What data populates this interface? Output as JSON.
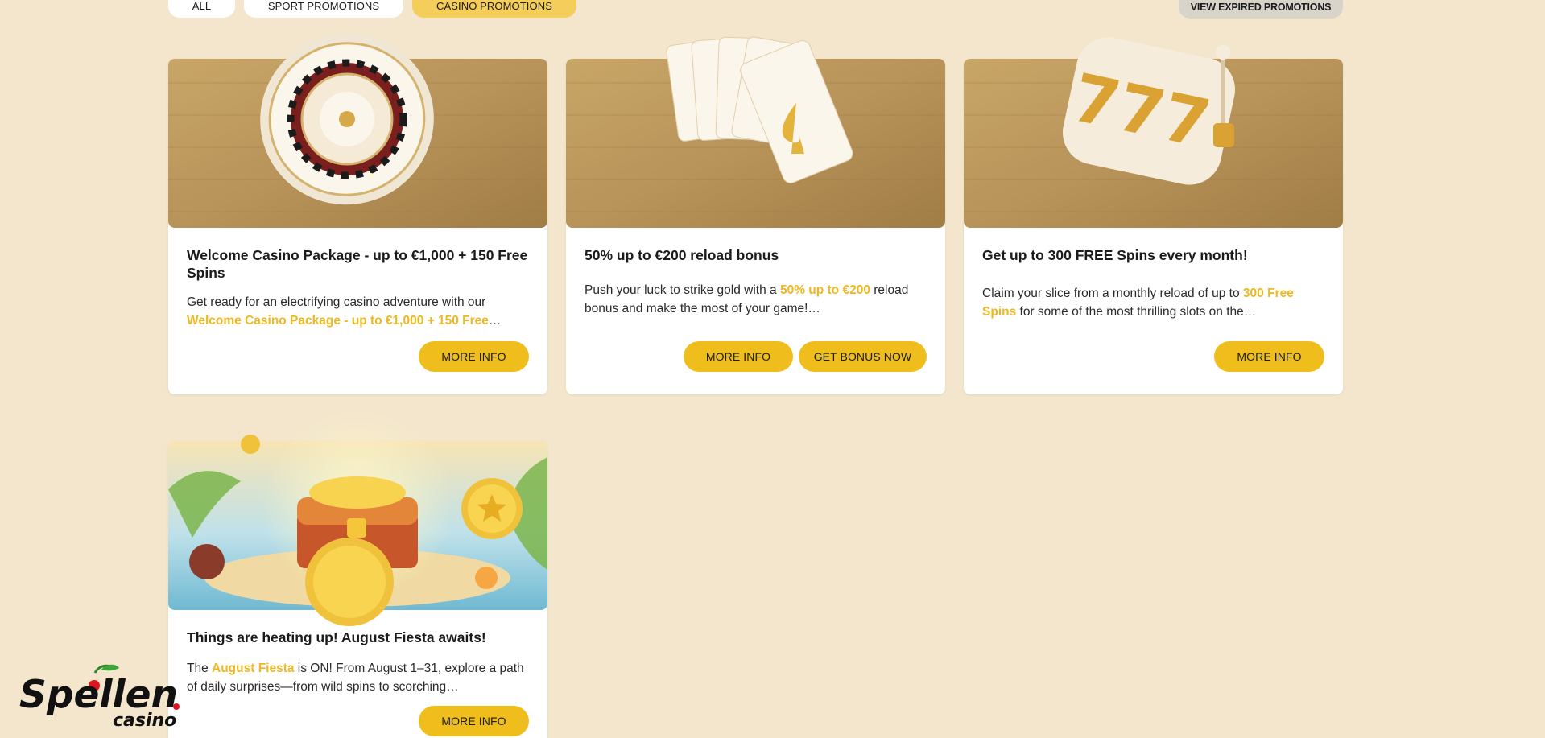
{
  "tabs": {
    "all": "ALL",
    "sport": "SPORT PROMOTIONS",
    "casino": "CASINO PROMOTIONS"
  },
  "view_expired": "VIEW EXPIRED PROMOTIONS",
  "cards": [
    {
      "title": "Welcome Casino Package - up to €1,000 + 150 Free Spins",
      "text_before": "Get ready for an electrifying casino adventure with our ",
      "highlight": "Welcome Casino Package - up to €1,000 + 150 Free",
      "text_after": "…",
      "buttons": [
        "MORE INFO"
      ],
      "image": "roulette-wheel"
    },
    {
      "title": "50% up to €200 reload bonus",
      "text_before": "Push your luck to strike gold with a ",
      "highlight": "50% up to €200",
      "text_after": " reload bonus and make the most of your game!…",
      "buttons": [
        "MORE INFO",
        "GET BONUS NOW"
      ],
      "image": "playing-cards"
    },
    {
      "title": "Get up to 300 FREE Spins every month!",
      "text_before": "Claim your slice from a monthly reload of up to ",
      "highlight": "300 Free Spins",
      "text_after": " for some of the most thrilling slots on the…",
      "buttons": [
        "MORE INFO"
      ],
      "image": "slot-reels-777"
    },
    {
      "title": "Things are heating up! August Fiesta awaits!",
      "text_before": "The ",
      "highlight": "August Fiesta",
      "text_after": " is ON! From August 1–31, explore a path of daily surprises—from wild spins to scorching…",
      "buttons": [
        "MORE INFO"
      ],
      "image": "treasure-chest-island"
    }
  ],
  "logo": {
    "text": "Spellen",
    "sub": "casino"
  },
  "colors": {
    "background": "#f3e6cc",
    "accent": "#efbe1d",
    "highlight_text": "#f0b81f",
    "active_tab": "#f4cd5a"
  }
}
